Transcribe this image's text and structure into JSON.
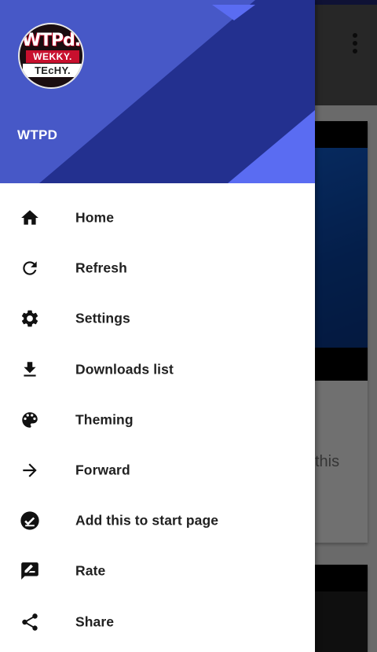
{
  "background": {
    "text_fragment": "this"
  },
  "drawer": {
    "header": {
      "logo": {
        "line1": "WTPd.",
        "line2": "WEKKY.",
        "line3": "TEcHY."
      },
      "title": "WTPD",
      "colors": {
        "light": "#4758c7",
        "dark": "#23308f",
        "accent": "#5a6cf2"
      }
    },
    "items": [
      {
        "label": "Home",
        "icon": "home-icon"
      },
      {
        "label": "Refresh",
        "icon": "refresh-icon"
      },
      {
        "label": "Settings",
        "icon": "settings-icon"
      },
      {
        "label": "Downloads list",
        "icon": "download-icon"
      },
      {
        "label": "Theming",
        "icon": "palette-icon"
      },
      {
        "label": "Forward",
        "icon": "arrow-forward-icon"
      },
      {
        "label": "Add this to start page",
        "icon": "check-circle-icon"
      },
      {
        "label": "Rate",
        "icon": "rate-review-icon"
      },
      {
        "label": "Share",
        "icon": "share-icon"
      }
    ]
  }
}
